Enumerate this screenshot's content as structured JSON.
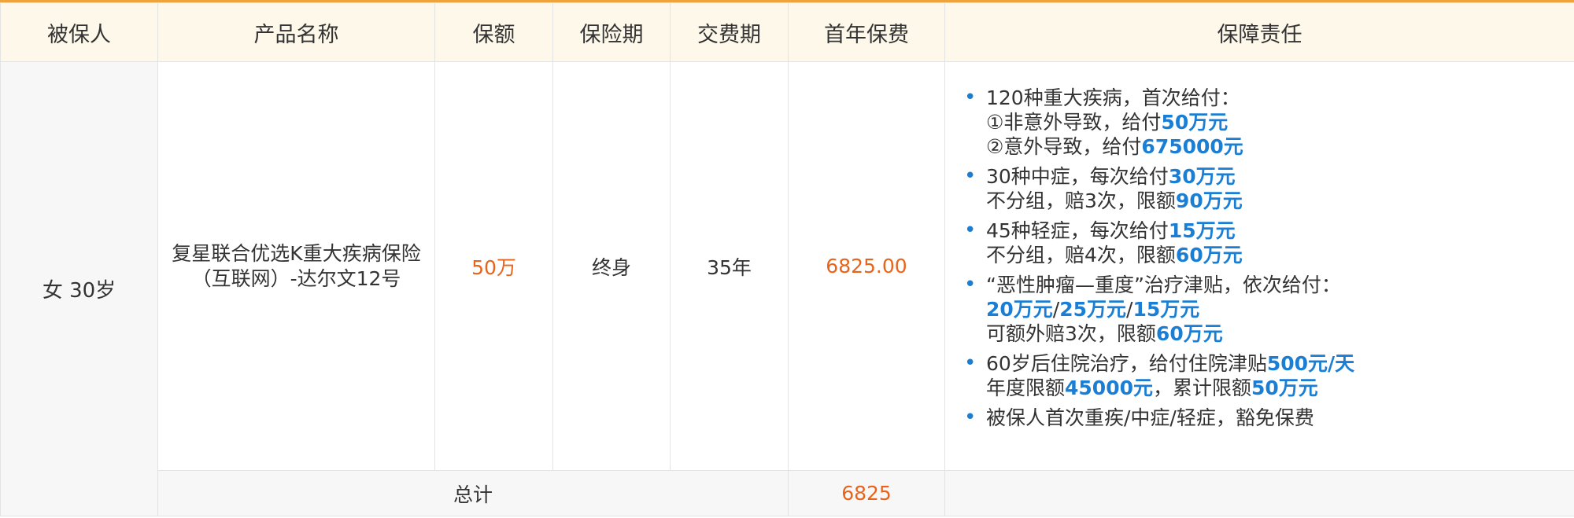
{
  "headers": [
    "被保人",
    "产品名称",
    "保额",
    "保险期",
    "交费期",
    "首年保费",
    "保障责任"
  ],
  "row": {
    "insured": "女 30岁",
    "product_line1": "复星联合优选K重大疾病保险",
    "product_line2": "（互联网）-达尔文12号",
    "amount": "50万",
    "period": "终身",
    "pay_period": "35年",
    "premium": "6825.00"
  },
  "duties": [
    {
      "lines": [
        [
          {
            "t": "120种重大疾病，首次给付："
          }
        ],
        [
          {
            "t": "①非意外导致，给付"
          },
          {
            "t": "50万元",
            "h": true
          }
        ],
        [
          {
            "t": "②意外导致，给付"
          },
          {
            "t": "675000元",
            "h": true
          }
        ]
      ]
    },
    {
      "lines": [
        [
          {
            "t": "30种中症，每次给付"
          },
          {
            "t": "30万元",
            "h": true
          }
        ],
        [
          {
            "t": "不分组，赔3次，限额"
          },
          {
            "t": "90万元",
            "h": true
          }
        ]
      ]
    },
    {
      "lines": [
        [
          {
            "t": "45种轻症，每次给付"
          },
          {
            "t": "15万元",
            "h": true
          }
        ],
        [
          {
            "t": "不分组，赔4次，限额"
          },
          {
            "t": "60万元",
            "h": true
          }
        ]
      ]
    },
    {
      "lines": [
        [
          {
            "t": "“恶性肿瘤—重度”治疗津贴，依次给付："
          }
        ],
        [
          {
            "t": "20万元",
            "h": true
          },
          {
            "t": "/"
          },
          {
            "t": "25万元",
            "h": true
          },
          {
            "t": "/"
          },
          {
            "t": "15万元",
            "h": true
          }
        ],
        [
          {
            "t": "可额外赔3次，限额"
          },
          {
            "t": "60万元",
            "h": true
          }
        ]
      ]
    },
    {
      "lines": [
        [
          {
            "t": "60岁后住院治疗，给付住院津贴"
          },
          {
            "t": "500元/天",
            "h": true
          }
        ],
        [
          {
            "t": "年度限额"
          },
          {
            "t": "45000元",
            "h": true
          },
          {
            "t": "，累计限额"
          },
          {
            "t": "50万元",
            "h": true
          }
        ]
      ]
    },
    {
      "lines": [
        [
          {
            "t": "被保人首次重疾/中症/轻症，豁免保费"
          }
        ]
      ]
    }
  ],
  "total": {
    "label": "总计",
    "premium": "6825"
  },
  "colors": {
    "accent_border": "#f0a33c",
    "header_bg": "#fdf8ea",
    "orange": "#e8641b",
    "blue": "#1a7fd4"
  }
}
